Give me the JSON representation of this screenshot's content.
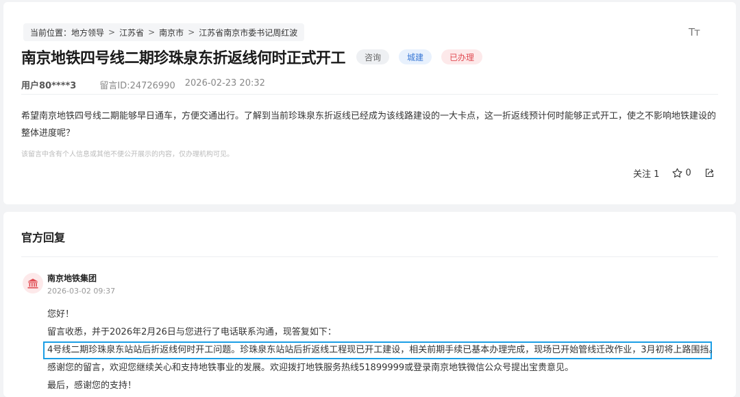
{
  "breadcrumb": {
    "prefix": "当前位置：",
    "items": [
      "地方领导",
      "江苏省",
      "南京市",
      "江苏省南京市委书记周红波"
    ],
    "separator": ">"
  },
  "font_size_toggle": "Tт",
  "message": {
    "title": "南京地铁四号线二期珍珠泉东折返线何时正式开工",
    "tags": [
      "咨询",
      "城建",
      "已办理"
    ],
    "user": "用户80****3",
    "message_id": "留言ID:24726990",
    "datetime": "2026-02-23 20:32",
    "content": "希望南京地铁四号线二期能够早日通车，方便交通出行。了解到当前珍珠泉东折返线已经成为该线路建设的一大卡点，这一折返线预计何时能够正式开工，使之不影响地铁建设的整体进度呢？",
    "privacy_note": "该留言中含有个人信息或其他不便公开展示的内容，仅办理机构可见。",
    "follow_label": "关注",
    "follow_count": "1",
    "star_count": "0"
  },
  "reply": {
    "section_title": "官方回复",
    "org_name": "南京地铁集团",
    "org_time": "2026-03-02 09:37",
    "lines": [
      "您好！",
      "留言收悉，并于2026年2月26日与您进行了电话联系沟通，现答复如下：",
      "4号线二期珍珠泉东站站后折返线何时开工问题。珍珠泉东站站后折返线工程现已开工建设，相关前期手续已基本办理完成，现场已开始管线迁改作业，3月初将上路围挡。",
      "感谢您的留言，欢迎您继续关心和支持地铁事业的发展。欢迎拨打地铁服务热线51899999或登录南京地铁微信公众号提出宝贵意见。",
      "最后，感谢您的支持！"
    ]
  },
  "colors": {
    "highlight_border": "#1a9de5",
    "tag_blue": "#3a79d6",
    "tag_red": "#e04b52"
  }
}
